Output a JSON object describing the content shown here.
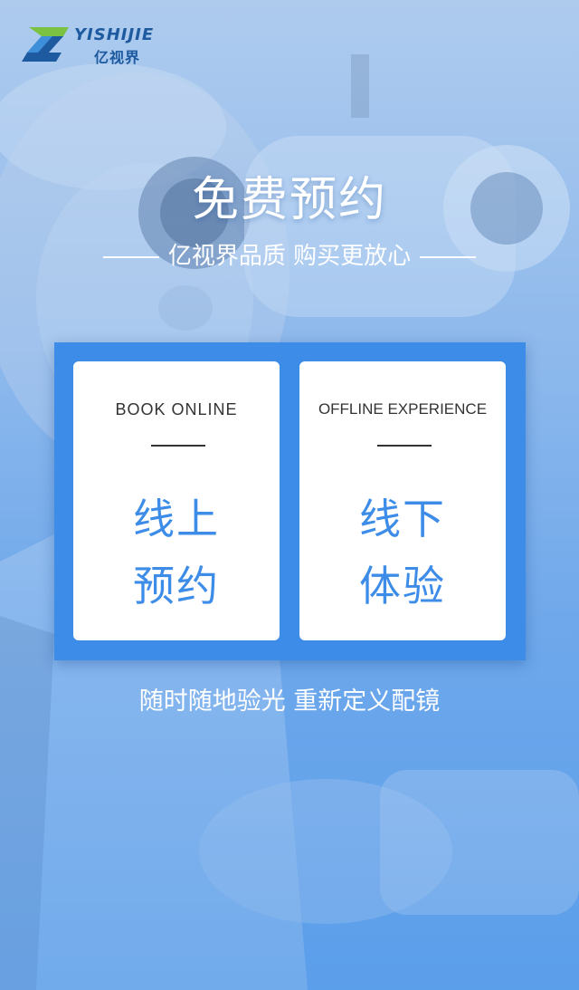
{
  "brand": {
    "name_en": "YISHIJIE",
    "name_cn": "亿视界",
    "colors": {
      "primary": "#3d8de8",
      "logo_blue": "#1e5aa0",
      "logo_green": "#7cc242"
    }
  },
  "hero": {
    "title": "免费预约",
    "subtitle": "亿视界品质 购买更放心"
  },
  "cards": [
    {
      "label_en": "BOOK ONLINE",
      "line1": "线上",
      "line2": "预约"
    },
    {
      "label_en": "OFFLINE EXPERIENCE",
      "line1": "线下",
      "line2": "体验"
    }
  ],
  "tagline": "随时随地验光 重新定义配镜"
}
